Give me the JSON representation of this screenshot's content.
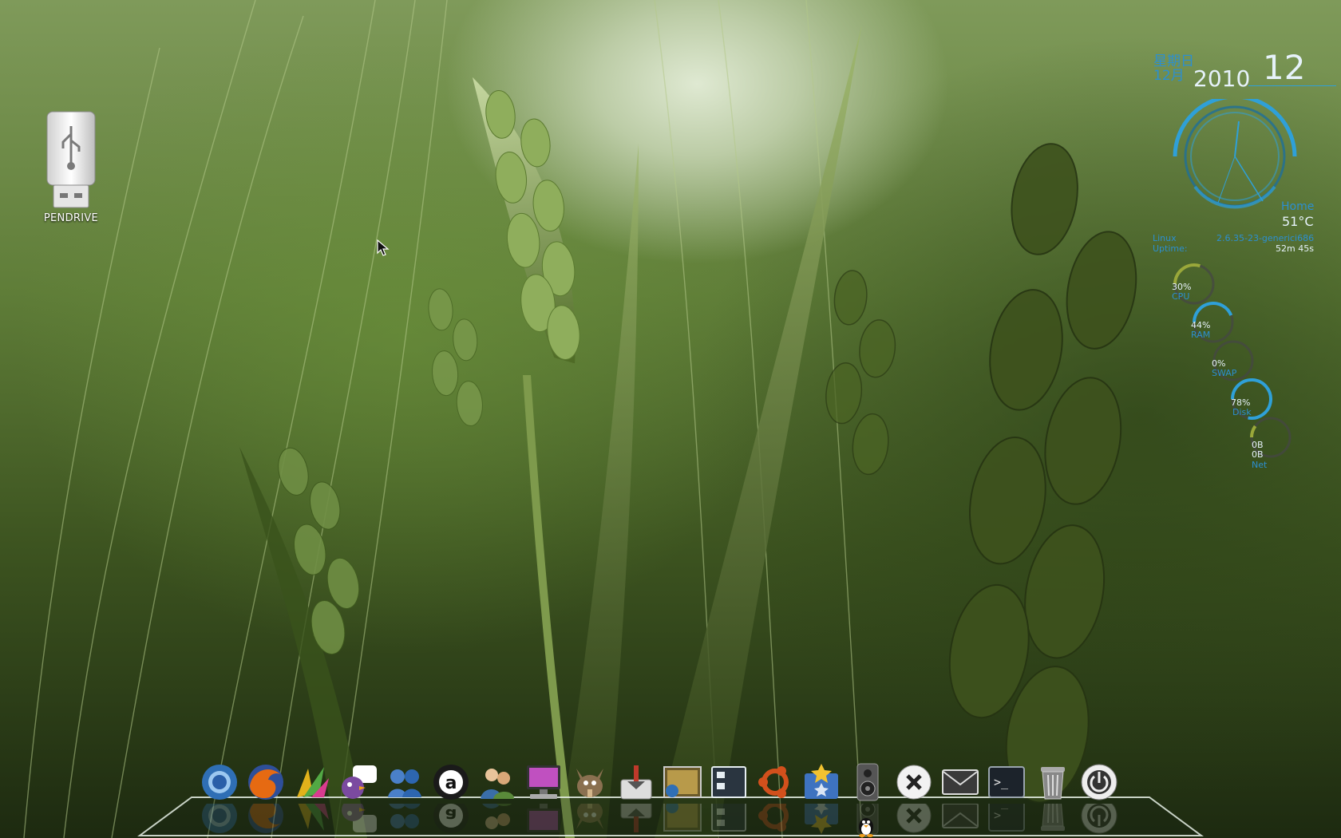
{
  "desktop": {
    "icons": [
      {
        "label": "PENDRIVE",
        "icon": "usb-drive-icon"
      }
    ]
  },
  "conky": {
    "weekday": "星期日",
    "month": "12月",
    "year": "2010",
    "day": "12",
    "clock_label": "Home",
    "temperature": "51°C",
    "os": "Linux",
    "kernel": "2.6.35-23-generici686",
    "uptime_label": "Uptime:",
    "uptime_value": "52m 45s",
    "gauges": [
      {
        "value": "30%",
        "label": "CPU",
        "level": 0.3,
        "color": "#9aa83a"
      },
      {
        "value": "44%",
        "label": "RAM",
        "level": 0.44,
        "color": "#2fa0d8"
      },
      {
        "value": "0%",
        "label": "SWAP",
        "level": 0.0,
        "color": "#2fa0d8"
      },
      {
        "value": "78%",
        "label": "Disk",
        "level": 0.78,
        "color": "#2fa0d8"
      },
      {
        "value_up": "0B",
        "value_down": "0B",
        "label": "Net",
        "level": 0.1,
        "color": "#9aa83a"
      }
    ]
  },
  "dock": {
    "items": [
      "chromium-icon",
      "firefox-icon",
      "inkscape-icon",
      "pidgin-icon",
      "empathy-icon",
      "amarok-icon",
      "user-accounts-icon",
      "display-icon",
      "gimp-icon",
      "installer-icon",
      "photo-viewer-icon",
      "file-manager-icon",
      "ubuntu-icon",
      "bookmarks-icon",
      "speaker-icon",
      "close-icon",
      "mail-icon",
      "terminal-icon",
      "trash-icon",
      "power-icon"
    ]
  },
  "colors": {
    "accent": "#2fa0d8",
    "text_light": "#e6f2fa"
  }
}
